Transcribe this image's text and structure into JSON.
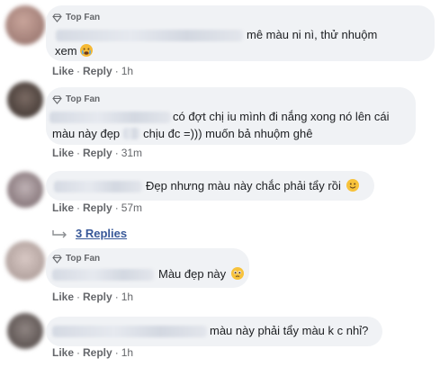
{
  "badge_label": "Top Fan",
  "actions": {
    "like": "Like",
    "reply": "Reply",
    "separator": "·"
  },
  "comments": [
    {
      "line1": "mê màu ni nì, thử nhuộm",
      "line2": "xem",
      "emoji": "crying-face",
      "time": "1h"
    },
    {
      "line1": "có đợt chị iu mình đi nắng xong nó lên cái",
      "line2_a": "màu này đẹp",
      "line2_b": "chịu đc =))) muốn bả nhuộm ghê",
      "time": "31m"
    },
    {
      "line1": "Đẹp nhưng màu này chắc phải tẩy rồi",
      "emoji": "smiling-face",
      "time": "57m"
    },
    {
      "line1": "Màu đẹp này",
      "emoji": "pleading-face",
      "time": "1h"
    },
    {
      "line1": "màu này phải tẩy màu k c nhỉ?",
      "time": "1h"
    }
  ],
  "replies_link": "3 Replies",
  "colors": {
    "bubble": "#f0f2f5",
    "meta": "#65676b",
    "link": "#385898"
  }
}
